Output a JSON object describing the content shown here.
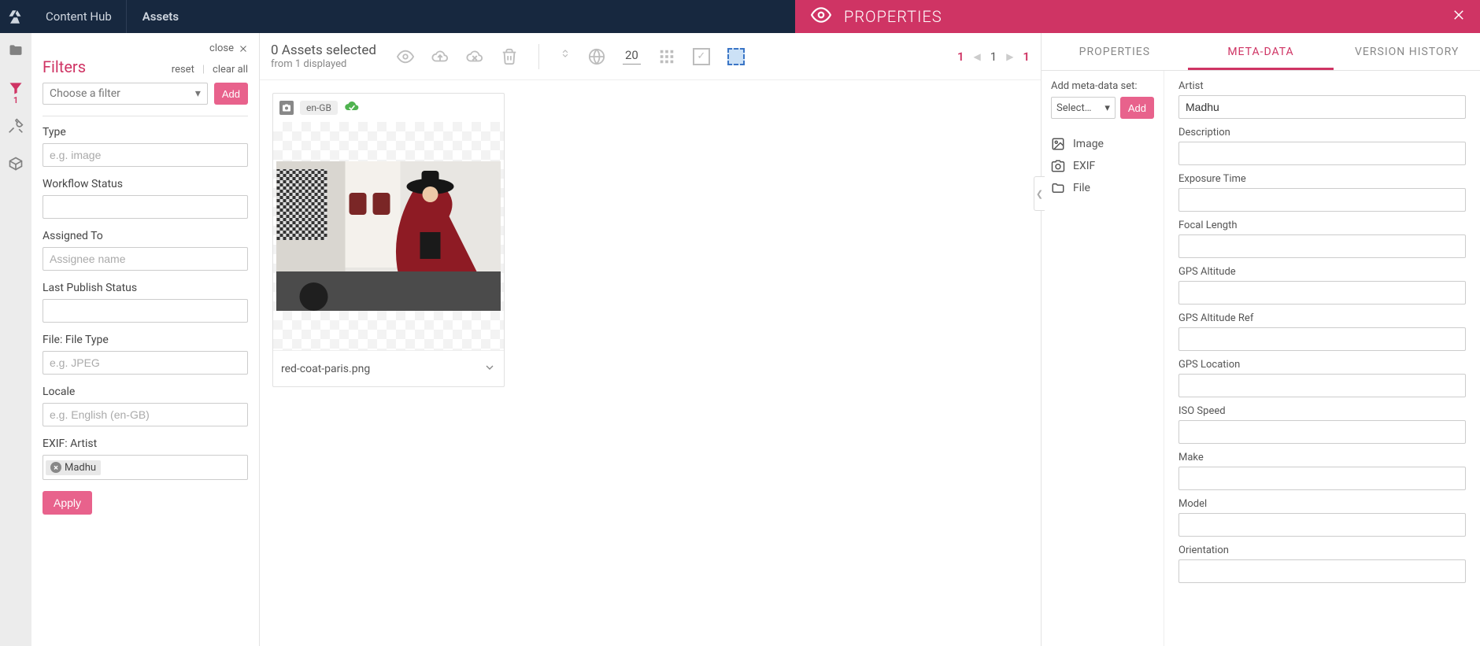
{
  "header": {
    "app_name": "Content Hub",
    "section": "Assets"
  },
  "rail": {
    "filter_badge": "1"
  },
  "filters": {
    "close": "close",
    "title": "Filters",
    "reset": "reset",
    "clear_all": "clear all",
    "choose_placeholder": "Choose a filter",
    "add": "Add",
    "groups": {
      "type": {
        "label": "Type",
        "placeholder": "e.g. image",
        "value": ""
      },
      "workflow_status": {
        "label": "Workflow Status",
        "value": ""
      },
      "assigned_to": {
        "label": "Assigned To",
        "placeholder": "Assignee name",
        "value": ""
      },
      "last_publish_status": {
        "label": "Last Publish Status",
        "value": ""
      },
      "file_type": {
        "label": "File: File Type",
        "placeholder": "e.g. JPEG",
        "value": ""
      },
      "locale": {
        "label": "Locale",
        "placeholder": "e.g. English (en-GB)",
        "value": ""
      },
      "exif_artist": {
        "label": "EXIF: Artist",
        "tag": "Madhu"
      }
    },
    "apply": "Apply"
  },
  "asset_bar": {
    "selected_line": "0 Assets selected",
    "displayed_line": "from 1 displayed",
    "page_size": "20",
    "pager": {
      "first": "1",
      "current": "1",
      "last": "1"
    }
  },
  "assets": [
    {
      "locale_chip": "en-GB",
      "filename": "red-coat-paris.png"
    }
  ],
  "props": {
    "header_title": "PROPERTIES",
    "tabs": {
      "properties": "PROPERTIES",
      "metadata": "META-DATA",
      "version": "VERSION HISTORY"
    },
    "add_set_label": "Add meta-data set:",
    "select_placeholder": "Select…",
    "add": "Add",
    "categories": {
      "image": "Image",
      "exif": "EXIF",
      "file": "File"
    },
    "fields": {
      "artist": {
        "label": "Artist",
        "value": "Madhu"
      },
      "description": {
        "label": "Description",
        "value": ""
      },
      "exposure_time": {
        "label": "Exposure Time",
        "value": ""
      },
      "focal_length": {
        "label": "Focal Length",
        "value": ""
      },
      "gps_altitude": {
        "label": "GPS Altitude",
        "value": ""
      },
      "gps_altitude_ref": {
        "label": "GPS Altitude Ref",
        "value": ""
      },
      "gps_location": {
        "label": "GPS Location",
        "value": ""
      },
      "iso_speed": {
        "label": "ISO Speed",
        "value": ""
      },
      "make": {
        "label": "Make",
        "value": ""
      },
      "model": {
        "label": "Model",
        "value": ""
      },
      "orientation": {
        "label": "Orientation",
        "value": ""
      }
    }
  }
}
